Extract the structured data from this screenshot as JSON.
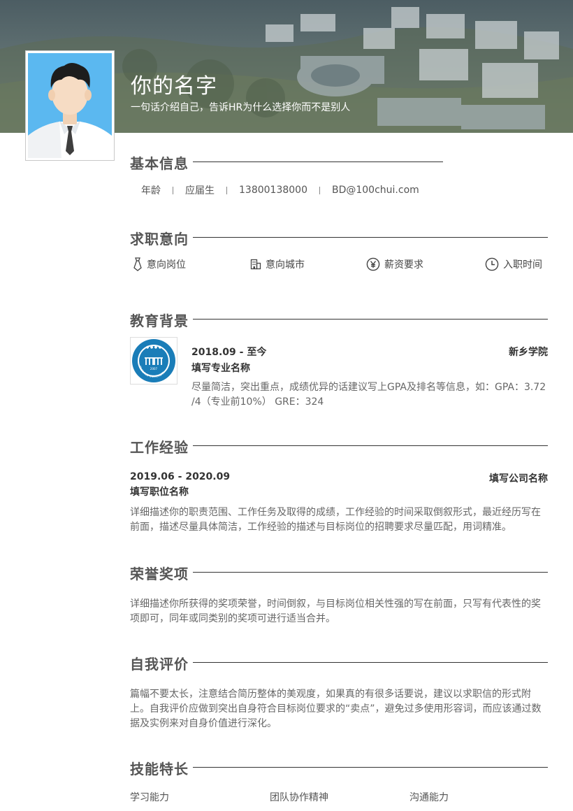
{
  "header": {
    "name": "你的名字",
    "tagline": "一句话介绍自己，告诉HR为什么选择你而不是别人"
  },
  "sections": {
    "basic": {
      "title": "基本信息",
      "items": [
        "年龄",
        "应届生",
        "13800138000",
        "BD@100chui.com"
      ]
    },
    "intent": {
      "title": "求职意向",
      "items": [
        {
          "label": "意向岗位",
          "icon": "tie-icon"
        },
        {
          "label": "意向城市",
          "icon": "building-icon"
        },
        {
          "label": "薪资要求",
          "icon": "yen-icon"
        },
        {
          "label": "入职时间",
          "icon": "clock-icon"
        }
      ]
    },
    "education": {
      "title": "教育背景",
      "date": "2018.09 - 至今",
      "school": "新乡学院",
      "major": "填写专业名称",
      "desc": "尽量简洁，突出重点，成绩优异的话建议写上GPA及排名等信息，如：GPA：3.72 /4（专业前10%） GRE：324",
      "logo_year": "2007",
      "logo_text": "XINXIANG UNIVERSITY"
    },
    "work": {
      "title": "工作经验",
      "date": "2019.06 - 2020.09",
      "company": "填写公司名称",
      "position": "填写职位名称",
      "desc": "详细描述你的职责范围、工作任务及取得的成绩，工作经验的时间采取倒叙形式，最近经历写在前面，描述尽量具体简洁，工作经验的描述与目标岗位的招聘要求尽量匹配，用词精准。"
    },
    "honors": {
      "title": "荣誉奖项",
      "desc": "详细描述你所获得的奖项荣誉，时间倒叙，与目标岗位相关性强的写在前面，只写有代表性的奖项即可，同年或同类别的奖项可进行适当合并。"
    },
    "self": {
      "title": "自我评价",
      "desc": "篇幅不要太长，注意结合简历整体的美观度，如果真的有很多话要说，建议以求职信的形式附上。自我评价应做到突出自身符合目标岗位要求的“卖点”，避免过多使用形容词，而应该通过数据及实例来对自身价值进行深化。"
    },
    "skills": {
      "title": "技能特长",
      "items": [
        "学习能力",
        "团队协作精神",
        "沟通能力"
      ]
    }
  },
  "colors": {
    "accent_line": "#333333",
    "logo_blue": "#1a7db8",
    "avatar_bg": "#5bb8f0"
  }
}
